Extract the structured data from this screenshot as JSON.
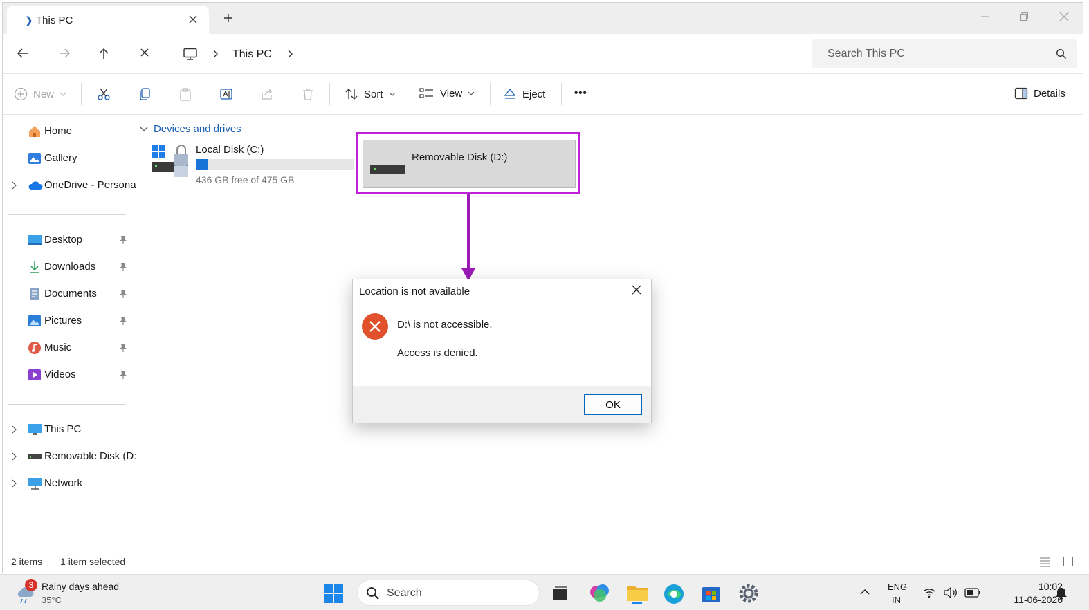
{
  "tab": {
    "title": "This PC"
  },
  "address": {
    "breadcrumb": "This PC",
    "search_placeholder": "Search This PC"
  },
  "commands": {
    "new": "New",
    "sort": "Sort",
    "view": "View",
    "eject": "Eject",
    "more": "•••",
    "details": "Details"
  },
  "sidebar": {
    "items": [
      {
        "label": "Home"
      },
      {
        "label": "Gallery"
      },
      {
        "label": "OneDrive - Persona"
      },
      {
        "label": "Desktop"
      },
      {
        "label": "Downloads"
      },
      {
        "label": "Documents"
      },
      {
        "label": "Pictures"
      },
      {
        "label": "Music"
      },
      {
        "label": "Videos"
      },
      {
        "label": "This PC"
      },
      {
        "label": "Removable Disk (D:"
      },
      {
        "label": "Network"
      }
    ]
  },
  "content": {
    "section": "Devices and drives",
    "drive_c": {
      "name": "Local Disk (C:)",
      "free": "436 GB free of 475 GB",
      "used_fraction": 0.08
    },
    "drive_d": {
      "name": "Removable Disk (D:)"
    }
  },
  "status": {
    "items": "2 items",
    "selected": "1 item selected"
  },
  "dialog": {
    "title": "Location is not available",
    "message": "D:\\ is not accessible.",
    "detail": "Access is denied.",
    "ok": "OK"
  },
  "taskbar": {
    "weather_title": "Rainy days ahead",
    "weather_temp": "35°C",
    "weather_badge": "3",
    "search": "Search",
    "lang_top": "ENG",
    "lang_bottom": "IN",
    "time": "10:02",
    "date": "11-06-2026"
  },
  "colors": {
    "accent": "#1a73d6",
    "highlight": "#c020d8",
    "error": "#e0502a"
  }
}
